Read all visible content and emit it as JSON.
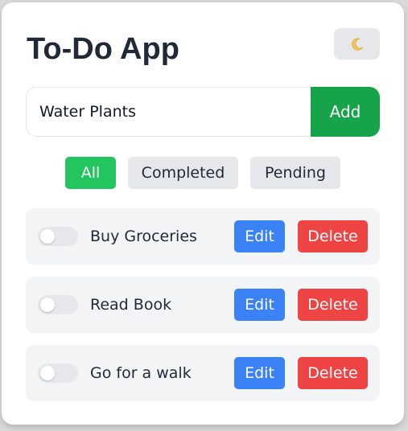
{
  "app": {
    "title": "To-Do App",
    "theme_toggle_icon": "crescent-moon-icon"
  },
  "new_task": {
    "value": "Water Plants",
    "add_label": "Add"
  },
  "filters": [
    {
      "label": "All",
      "active": true
    },
    {
      "label": "Completed",
      "active": false
    },
    {
      "label": "Pending",
      "active": false
    }
  ],
  "tasks": [
    {
      "label": "Buy Groceries",
      "completed": false,
      "edit_label": "Edit",
      "delete_label": "Delete"
    },
    {
      "label": "Read Book",
      "completed": false,
      "edit_label": "Edit",
      "delete_label": "Delete"
    },
    {
      "label": "Go for a walk",
      "completed": false,
      "edit_label": "Edit",
      "delete_label": "Delete"
    }
  ],
  "colors": {
    "add_button": "#16a34a",
    "active_filter": "#22c55e",
    "edit_button": "#3b82f6",
    "delete_button": "#ef4444"
  }
}
